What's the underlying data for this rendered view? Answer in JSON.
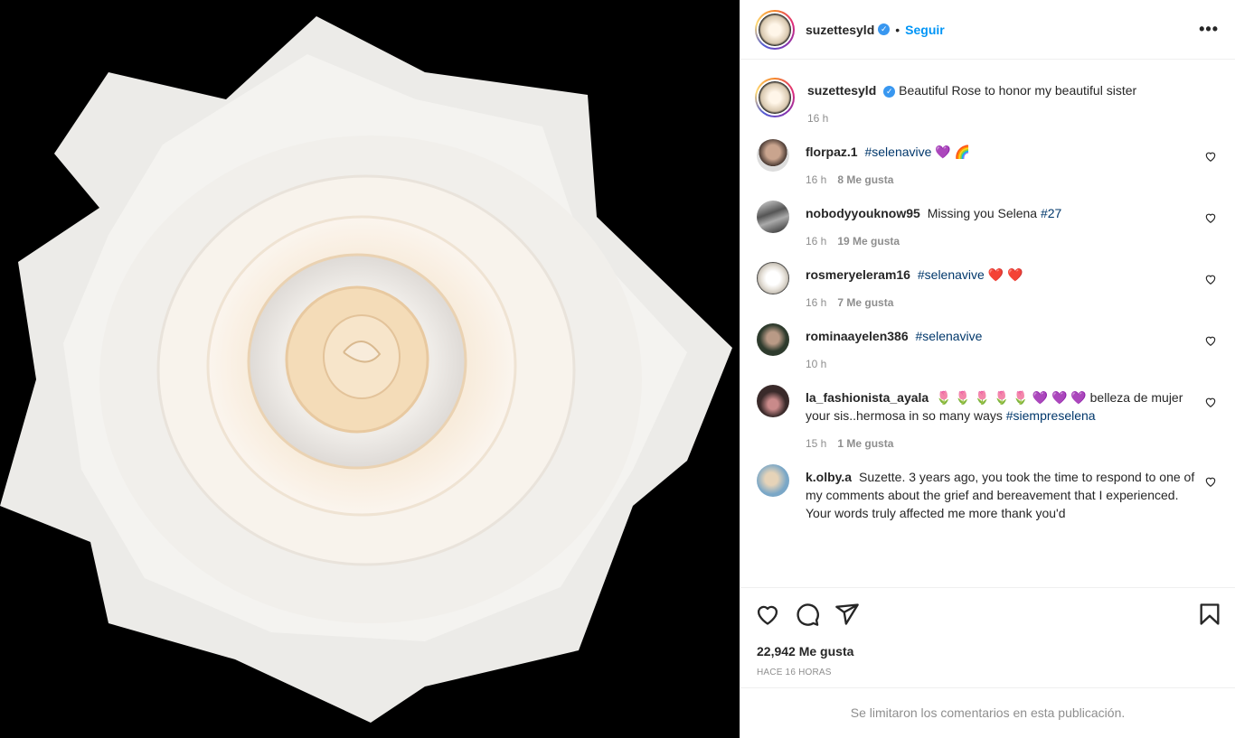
{
  "post": {
    "username": "suzettesyld",
    "follow_label": "Seguir",
    "dot": "•",
    "more": "•••",
    "caption_text": "Beautiful Rose to honor my beautiful sister",
    "caption_time": "16 h"
  },
  "comments": [
    {
      "user": "florpaz.1",
      "text": "#selenavive 💜 🌈",
      "time": "16 h",
      "likes": "8 Me gusta"
    },
    {
      "user": "nobodyyouknow95",
      "text_plain": "Missing you Selena ",
      "text_tag": "#27",
      "time": "16 h",
      "likes": "19 Me gusta"
    },
    {
      "user": "rosmeryeleram16",
      "text": "#selenavive ❤️ ❤️",
      "time": "16 h",
      "likes": "7 Me gusta"
    },
    {
      "user": "rominaayelen386",
      "text": "#selenavive",
      "time": "10 h"
    },
    {
      "user": "la_fashionista_ayala",
      "text_plain": "🌷 🌷 🌷 🌷 🌷 💜 💜 💜 belleza de mujer your sis..hermosa in so many ways ",
      "text_tag": "#siempreselena",
      "time": "15 h",
      "likes": "1 Me gusta"
    },
    {
      "user": "k.olby.a",
      "text": "Suzette. 3 years ago, you took the time to respond to one of my comments about the grief and bereavement that I experienced. Your words truly affected me more thank you'd"
    }
  ],
  "footer": {
    "likes": "22,942 Me gusta",
    "time": "HACE 16 HORAS",
    "limited": "Se limitaron los comentarios en esta publicación."
  },
  "colors": {
    "link": "#0095f6",
    "hashtag": "#00376b",
    "muted": "#8e8e8e"
  }
}
